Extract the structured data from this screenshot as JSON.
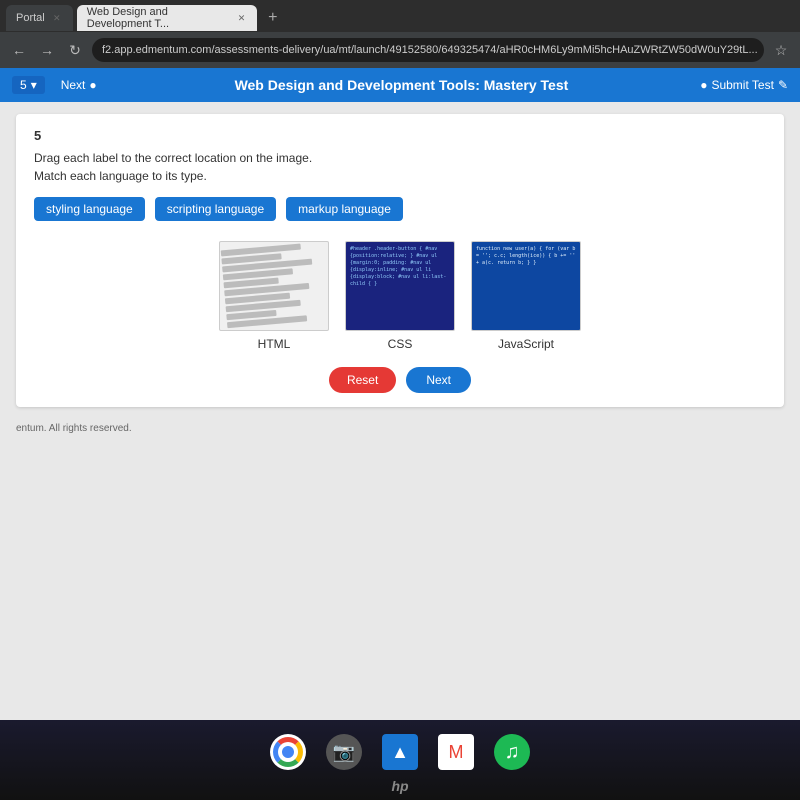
{
  "browser": {
    "tabs": [
      {
        "label": "Portal",
        "active": false
      },
      {
        "label": "Web Design and Development T...",
        "active": true
      }
    ],
    "address": "f2.app.edmentum.com/assessments-delivery/ua/mt/launch/49152580/649325474/aHR0cHM6Ly9mMi5hcHAuZWRtZW50dW0uY29tL...",
    "toolbar_question": "5",
    "toolbar_next": "Next",
    "toolbar_title": "Web Design and Development Tools: Mastery Test",
    "submit_test": "Submit Test"
  },
  "question": {
    "number": "5",
    "instruction": "Drag each label to the correct location on the image.",
    "subinstruction": "Match each language to its type.",
    "labels": [
      {
        "text": "styling language",
        "type": "styling"
      },
      {
        "text": "scripting language",
        "type": "scripting"
      },
      {
        "text": "markup language",
        "type": "markup"
      }
    ],
    "images": [
      {
        "name": "HTML",
        "type": "html",
        "code_lines": [
          "",
          "",
          "",
          "",
          "",
          "",
          "",
          "",
          ""
        ]
      },
      {
        "name": "CSS",
        "type": "css",
        "code_text": "#header .header-button {\n#nav {position:relative; }\n#nav ul {margin:0; padding:\n#nav ul {display:inline;\n#nav ul li {display:block;\n#nav ul li:last-child { }"
      },
      {
        "name": "JavaScript",
        "type": "js",
        "code_text": "function new user(a) {\n  for (var b = ''; c.c;\n    length(ice)) {\n      b += '' + a(c.\n      return b;\n  }\n}"
      }
    ],
    "reset_label": "Reset",
    "next_label": "Next"
  },
  "footer": {
    "text": "entum. All rights reserved."
  },
  "taskbar": {
    "icons": [
      {
        "name": "chrome",
        "symbol": "⊙"
      },
      {
        "name": "camera",
        "symbol": "📷"
      },
      {
        "name": "drive",
        "symbol": "▲"
      },
      {
        "name": "gmail",
        "symbol": "M"
      },
      {
        "name": "spotify",
        "symbol": "♪"
      }
    ],
    "brand": "hp"
  }
}
